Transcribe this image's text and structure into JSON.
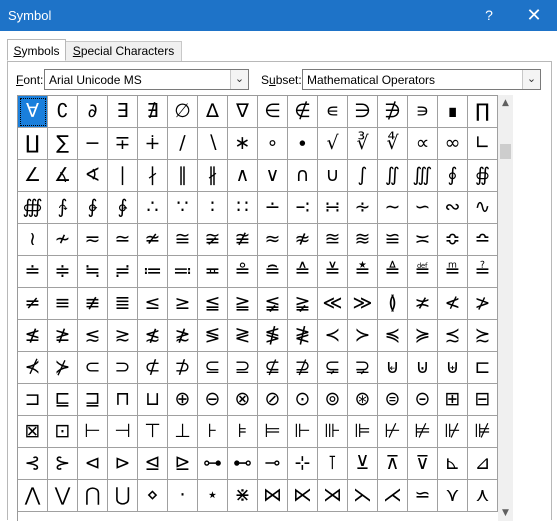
{
  "window": {
    "title": "Symbol",
    "help_glyph": "?",
    "close_glyph": "✕",
    "accent_color": "#1e73c8"
  },
  "tabs": [
    {
      "label_prefix": "",
      "mnemonic": "S",
      "label_suffix": "ymbols",
      "active": true
    },
    {
      "label_prefix": "",
      "mnemonic": "S",
      "label_suffix": "pecial Characters",
      "active": false
    }
  ],
  "font_selector": {
    "mnemonic": "F",
    "label_suffix": "ont:",
    "value": "Arial Unicode MS"
  },
  "subset_selector": {
    "prefix": "S",
    "mnemonic": "u",
    "label_suffix": "bset:",
    "value": "Mathematical Operators"
  },
  "dropdown_glyph": "⌄",
  "scroll": {
    "up_glyph": "▲",
    "down_glyph": "▼"
  },
  "grid": {
    "selected_index": 0,
    "rows": [
      [
        "∀",
        "∁",
        "∂",
        "∃",
        "∄",
        "∅",
        "∆",
        "∇",
        "∈",
        "∉",
        "∊",
        "∋",
        "∌",
        "∍",
        "∎",
        "∏"
      ],
      [
        "∐",
        "∑",
        "−",
        "∓",
        "∔",
        "∕",
        "∖",
        "∗",
        "∘",
        "∙",
        "√",
        "∛",
        "∜",
        "∝",
        "∞",
        "∟"
      ],
      [
        "∠",
        "∡",
        "∢",
        "∣",
        "∤",
        "∥",
        "∦",
        "∧",
        "∨",
        "∩",
        "∪",
        "∫",
        "∬",
        "∭",
        "∮",
        "∯"
      ],
      [
        "∰",
        "∱",
        "∲",
        "∳",
        "∴",
        "∵",
        "∶",
        "∷",
        "∸",
        "∹",
        "∺",
        "∻",
        "∼",
        "∽",
        "∾",
        "∿"
      ],
      [
        "≀",
        "≁",
        "≂",
        "≃",
        "≄",
        "≅",
        "≆",
        "≇",
        "≈",
        "≉",
        "≊",
        "≋",
        "≌",
        "≍",
        "≎",
        "≏"
      ],
      [
        "≐",
        "≑",
        "≒",
        "≓",
        "≔",
        "≕",
        "≖",
        "≗",
        "≘",
        "≙",
        "≚",
        "≛",
        "≜",
        "≝",
        "≞",
        "≟"
      ],
      [
        "≠",
        "≡",
        "≢",
        "≣",
        "≤",
        "≥",
        "≦",
        "≧",
        "≨",
        "≩",
        "≪",
        "≫",
        "≬",
        "≭",
        "≮",
        "≯"
      ],
      [
        "≰",
        "≱",
        "≲",
        "≳",
        "≴",
        "≵",
        "≶",
        "≷",
        "≸",
        "≹",
        "≺",
        "≻",
        "≼",
        "≽",
        "≾",
        "≿"
      ],
      [
        "⊀",
        "⊁",
        "⊂",
        "⊃",
        "⊄",
        "⊅",
        "⊆",
        "⊇",
        "⊈",
        "⊉",
        "⊊",
        "⊋",
        "⊌",
        "⊍",
        "⊎",
        "⊏"
      ],
      [
        "⊐",
        "⊑",
        "⊒",
        "⊓",
        "⊔",
        "⊕",
        "⊖",
        "⊗",
        "⊘",
        "⊙",
        "⊚",
        "⊛",
        "⊜",
        "⊝",
        "⊞",
        "⊟"
      ],
      [
        "⊠",
        "⊡",
        "⊢",
        "⊣",
        "⊤",
        "⊥",
        "⊦",
        "⊧",
        "⊨",
        "⊩",
        "⊪",
        "⊫",
        "⊬",
        "⊭",
        "⊮",
        "⊯"
      ],
      [
        "⊰",
        "⊱",
        "⊲",
        "⊳",
        "⊴",
        "⊵",
        "⊶",
        "⊷",
        "⊸",
        "⊹",
        "⊺",
        "⊻",
        "⊼",
        "⊽",
        "⊾",
        "⊿"
      ],
      [
        "⋀",
        "⋁",
        "⋂",
        "⋃",
        "⋄",
        "⋅",
        "⋆",
        "⋇",
        "⋈",
        "⋉",
        "⋊",
        "⋋",
        "⋌",
        "⋍",
        "⋎",
        "⋏"
      ]
    ]
  }
}
